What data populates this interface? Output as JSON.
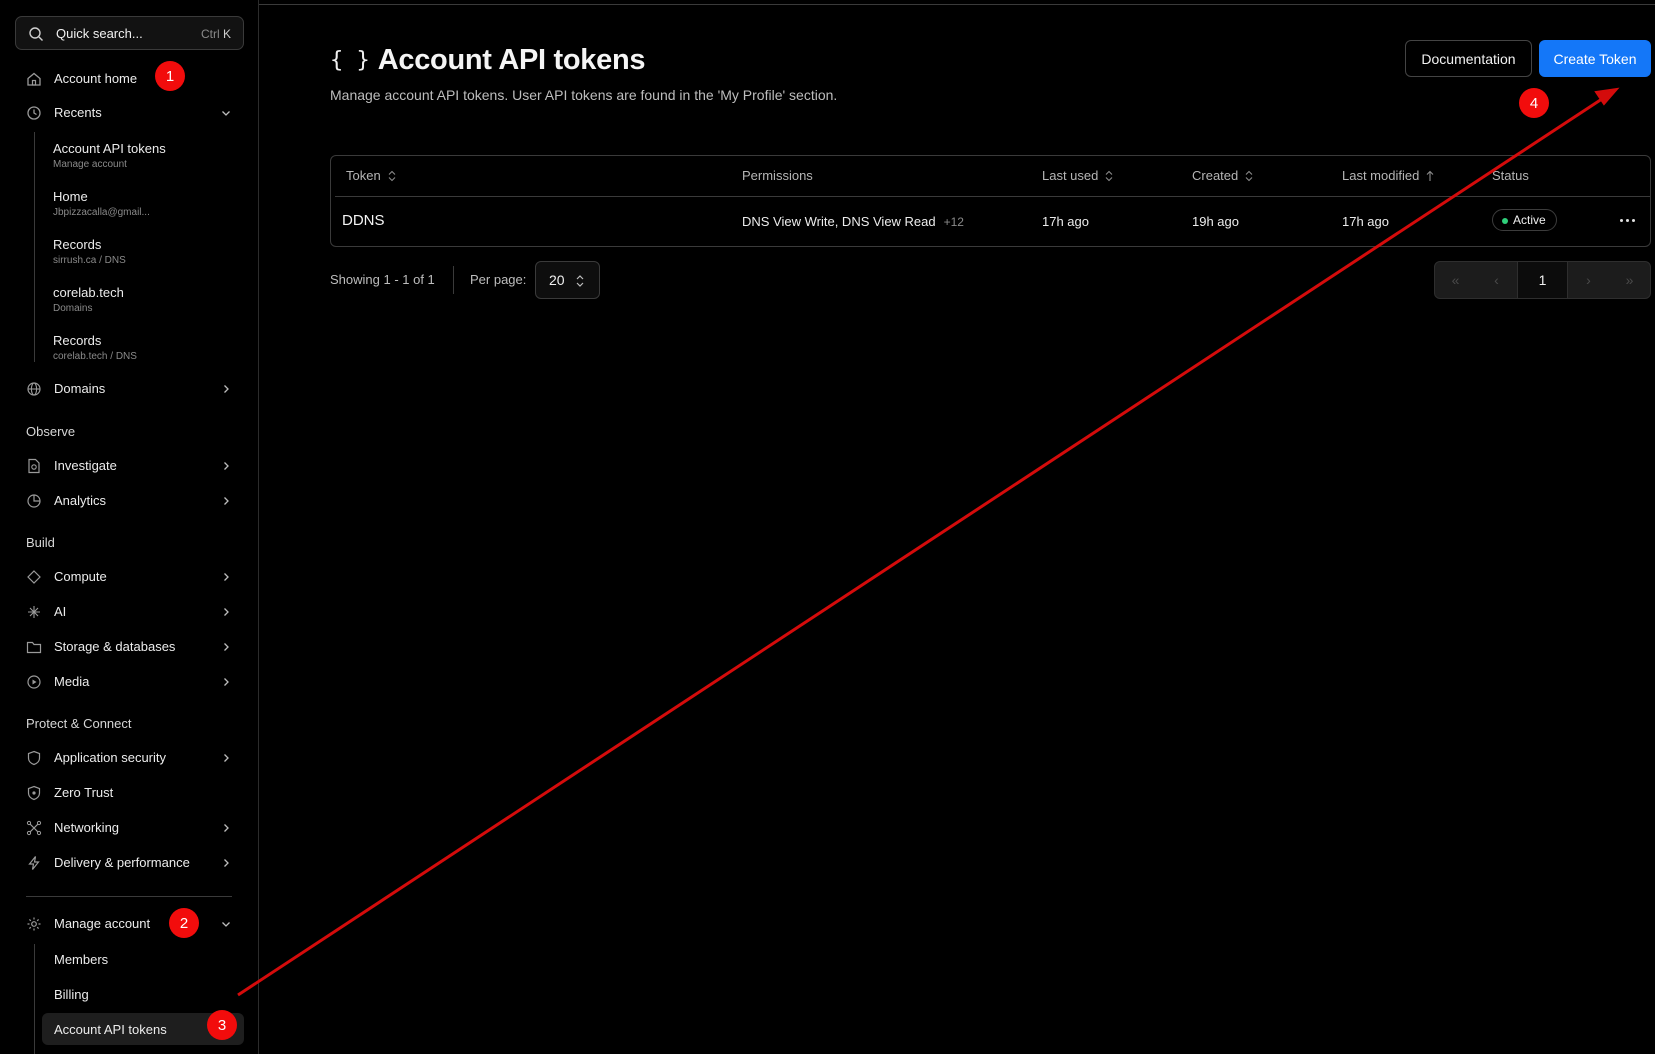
{
  "search": {
    "placeholder": "Quick search...",
    "shortcut_mod": "Ctrl",
    "shortcut_key": "K"
  },
  "sidebar": {
    "account_home": "Account home",
    "recents_label": "Recents",
    "recents": [
      {
        "title": "Account API tokens",
        "sub": "Manage account"
      },
      {
        "title": "Home",
        "sub": "Jbpizzacalla@gmail..."
      },
      {
        "title": "Records",
        "sub": "sirrush.ca  /  DNS"
      },
      {
        "title": "corelab.tech",
        "sub": "Domains"
      },
      {
        "title": "Records",
        "sub": "corelab.tech  /  DNS"
      }
    ],
    "domains": "Domains",
    "observe_header": "Observe",
    "investigate": "Investigate",
    "analytics": "Analytics",
    "build_header": "Build",
    "compute": "Compute",
    "ai": "AI",
    "storage": "Storage & databases",
    "media": "Media",
    "protect_header": "Protect & Connect",
    "app_security": "Application security",
    "zero_trust": "Zero Trust",
    "networking": "Networking",
    "delivery": "Delivery & performance",
    "manage_account": "Manage account",
    "members": "Members",
    "billing": "Billing",
    "account_api_tokens": "Account API tokens"
  },
  "main": {
    "title_icon": "{ }",
    "title": "Account API tokens",
    "subtitle": "Manage account API tokens. User API tokens are found in the 'My Profile' section.",
    "documentation_button": "Documentation",
    "create_button": "Create Token"
  },
  "table": {
    "headers": {
      "token": "Token",
      "permissions": "Permissions",
      "last_used": "Last used",
      "created": "Created",
      "last_modified": "Last modified",
      "status": "Status"
    },
    "rows": [
      {
        "token": "DDNS",
        "permissions": "DNS View Write, DNS View Read",
        "extra": "+12",
        "last_used": "17h ago",
        "created": "19h ago",
        "last_modified": "17h ago",
        "status": "Active"
      }
    ]
  },
  "footer": {
    "showing": "Showing 1 - 1 of 1",
    "per_page_label": "Per page:",
    "per_page_value": "20",
    "current_page": "1"
  },
  "annotations": {
    "badge1": "1",
    "badge2": "2",
    "badge3": "3",
    "badge4": "4",
    "color": "#f20c0c"
  }
}
